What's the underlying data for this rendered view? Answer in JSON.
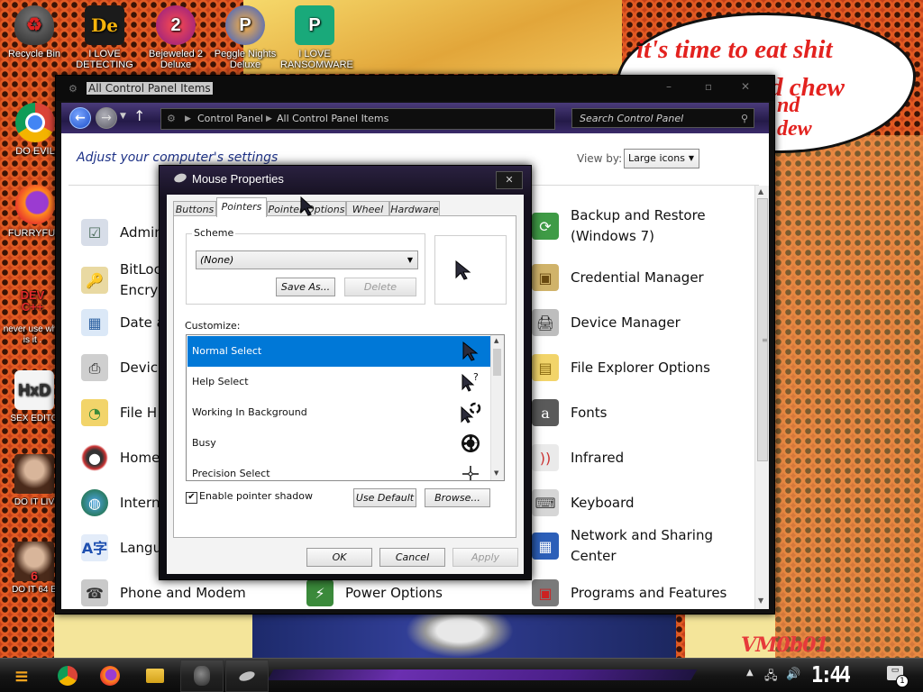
{
  "desktop": {
    "icons": [
      {
        "label": "Recycle Bin"
      },
      {
        "label": "I LOVE DETECTING"
      },
      {
        "label": "Bejeweled 2 Deluxe"
      },
      {
        "label": "Peggle Nights Deluxe"
      },
      {
        "label": "I LOVE RANSOMWARE"
      },
      {
        "label": "DO EVIL"
      },
      {
        "label": "FURRYFUC"
      },
      {
        "label": "never use why is it ."
      },
      {
        "label": "SEX EDITO"
      },
      {
        "label": "DO IT LIV"
      },
      {
        "label": "DO IT 64 B"
      }
    ],
    "bubble_line1": "it's time to eat shit",
    "bubble_line2": "d chew",
    "bubble_line3": "nd",
    "bubble_line4": "dew",
    "watermark": "VM0b01"
  },
  "control_panel": {
    "title": "All Control Panel Items",
    "breadcrumb": [
      "Control Panel",
      "All Control Panel Items"
    ],
    "search_placeholder": "Search Control Panel",
    "heading": "Adjust your computer's settings",
    "view_by_label": "View by:",
    "view_by_value": "Large icons",
    "items_col1": [
      {
        "label": "Admin",
        "icon": "admin-tools-icon"
      },
      {
        "label": "BitLoc\nEncryp",
        "icon": "bitlocker-icon"
      },
      {
        "label": "Date a",
        "icon": "date-time-icon"
      },
      {
        "label": "Device",
        "icon": "devices-printers-icon"
      },
      {
        "label": "File H",
        "icon": "file-history-icon"
      },
      {
        "label": "HomeG",
        "icon": "homegroup-icon"
      },
      {
        "label": "Intern",
        "icon": "internet-options-icon"
      },
      {
        "label": "Langu",
        "icon": "language-icon"
      },
      {
        "label": "Phone and Modem",
        "icon": "phone-modem-icon"
      }
    ],
    "items_col2": [
      {
        "label": "Power Options",
        "icon": "power-options-icon"
      }
    ],
    "items_col3": [
      {
        "label": "Backup and Restore\n(Windows 7)",
        "icon": "backup-restore-icon"
      },
      {
        "label": "Credential Manager",
        "icon": "credential-manager-icon"
      },
      {
        "label": "Device Manager",
        "icon": "device-manager-icon"
      },
      {
        "label": "File Explorer Options",
        "icon": "folder-options-icon"
      },
      {
        "label": "Fonts",
        "icon": "fonts-icon"
      },
      {
        "label": "Infrared",
        "icon": "infrared-icon"
      },
      {
        "label": "Keyboard",
        "icon": "keyboard-icon"
      },
      {
        "label": "Network and Sharing\nCenter",
        "icon": "network-sharing-icon"
      },
      {
        "label": "Programs and Features",
        "icon": "programs-features-icon"
      }
    ]
  },
  "mouse_properties": {
    "title": "Mouse Properties",
    "close_label": "✕",
    "tabs": [
      "Buttons",
      "Pointers",
      "Pointer Options",
      "Wheel",
      "Hardware"
    ],
    "active_tab": "Pointers",
    "scheme_label": "Scheme",
    "scheme_value": "(None)",
    "save_as": "Save As...",
    "delete": "Delete",
    "customize_label": "Customize:",
    "pointers": [
      {
        "label": "Normal Select",
        "icon": "normal-select-cursor-icon",
        "selected": true
      },
      {
        "label": "Help Select",
        "icon": "help-select-cursor-icon",
        "selected": false
      },
      {
        "label": "Working In Background",
        "icon": "working-background-cursor-icon",
        "selected": false
      },
      {
        "label": "Busy",
        "icon": "busy-cursor-icon",
        "selected": false
      },
      {
        "label": "Precision Select",
        "icon": "precision-select-cursor-icon",
        "selected": false
      }
    ],
    "shadow_label": "Enable pointer shadow",
    "shadow_checked": true,
    "use_default": "Use Default",
    "browse": "Browse...",
    "ok": "OK",
    "cancel": "Cancel",
    "apply": "Apply"
  },
  "taskbar": {
    "clock": "1:44 AM",
    "notification_count": "1",
    "apps": [
      "start-icon",
      "chrome-icon",
      "firefox-icon",
      "file-explorer-icon",
      "control-panel-icon",
      "mouse-properties-icon"
    ]
  },
  "colors": {
    "heading": "#1e3287",
    "selection": "#0078d7",
    "bubble_text": "#e3221f"
  }
}
